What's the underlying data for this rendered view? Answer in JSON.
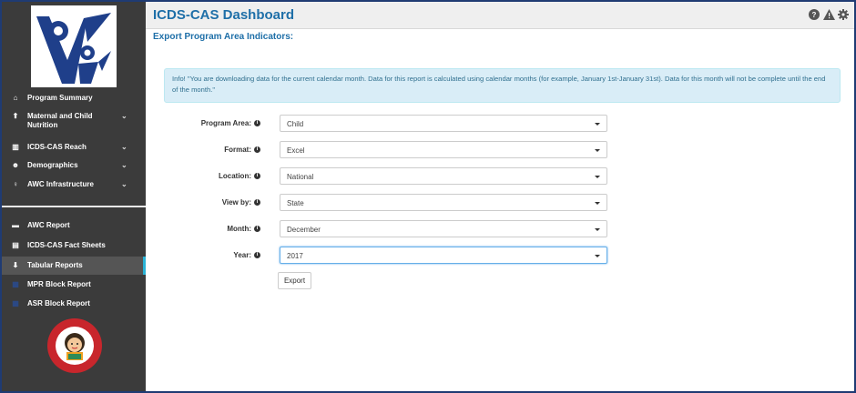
{
  "app": {
    "title": "ICDS-CAS Dashboard"
  },
  "header": {
    "icons": [
      "help-icon",
      "warning-icon",
      "gear-icon"
    ]
  },
  "sidebar": {
    "top_items": [
      {
        "label": "Program Summary",
        "icon": "home-icon",
        "has_chevron": false
      },
      {
        "label": "Maternal and Child Nutrition",
        "icon": "nutrition-icon",
        "has_chevron": true
      },
      {
        "label": "ICDS-CAS Reach",
        "icon": "bar-chart-icon",
        "has_chevron": true
      },
      {
        "label": "Demographics",
        "icon": "users-icon",
        "has_chevron": true
      },
      {
        "label": "AWC Infrastructure",
        "icon": "lightbulb-icon",
        "has_chevron": true
      }
    ],
    "bottom_items": [
      {
        "label": "AWC Report",
        "icon": "card-icon"
      },
      {
        "label": "ICDS-CAS Fact Sheets",
        "icon": "document-icon"
      },
      {
        "label": "Tabular Reports",
        "icon": "download-icon",
        "active": true
      },
      {
        "label": "MPR Block Report",
        "icon": "calendar-icon"
      },
      {
        "label": "ASR Block Report",
        "icon": "calendar-icon"
      }
    ],
    "active_color": "#2ab3d6"
  },
  "main": {
    "heading": "Export Program Area Indicators:",
    "info_text": "Info! \"You are downloading data for the current calendar month. Data for this report is calculated using calendar months (for example, January 1st-January 31st). Data for this month will not be complete until the end of the month.\"",
    "fields": [
      {
        "label": "Program Area:",
        "value": "Child"
      },
      {
        "label": "Format:",
        "value": "Excel"
      },
      {
        "label": "Location:",
        "value": "National"
      },
      {
        "label": "View by:",
        "value": "State"
      },
      {
        "label": "Month:",
        "value": "December"
      },
      {
        "label": "Year:",
        "value": "2017"
      }
    ],
    "export_label": "Export"
  },
  "colors": {
    "title_blue": "#1e6fa8",
    "sidebar_bg": "#3b3b3b",
    "logo_blue": "#1f3f8a",
    "info_bg": "#d9edf7"
  }
}
